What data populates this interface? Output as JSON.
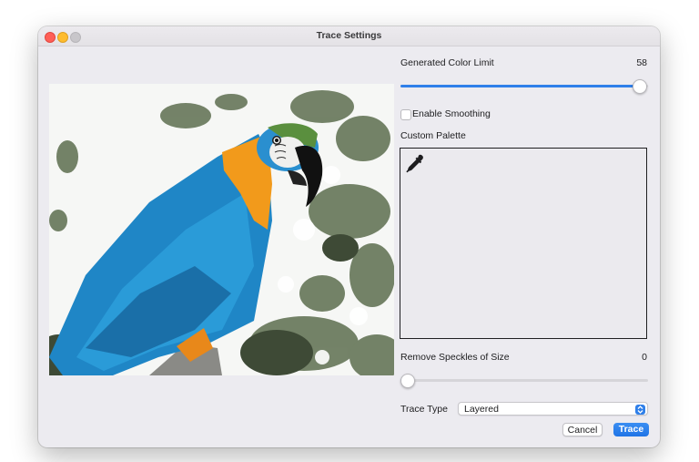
{
  "window": {
    "title": "Trace Settings"
  },
  "preview": {
    "subject": "parrot-photo"
  },
  "settings": {
    "color_limit": {
      "label": "Generated Color Limit",
      "value": "58",
      "level": 0.99
    },
    "smoothing": {
      "label": "Enable Smoothing",
      "checked": false
    },
    "palette": {
      "label": "Custom Palette",
      "icon": "eyedropper-icon"
    },
    "speckles": {
      "label": "Remove Speckles of Size",
      "value": "0",
      "level": 0.0
    },
    "trace_type": {
      "label": "Trace Type",
      "selected": "Layered"
    }
  },
  "buttons": {
    "cancel": "Cancel",
    "trace": "Trace"
  },
  "colors": {
    "accent": "#2f7fe9",
    "window_bg": "#ecebf0"
  }
}
